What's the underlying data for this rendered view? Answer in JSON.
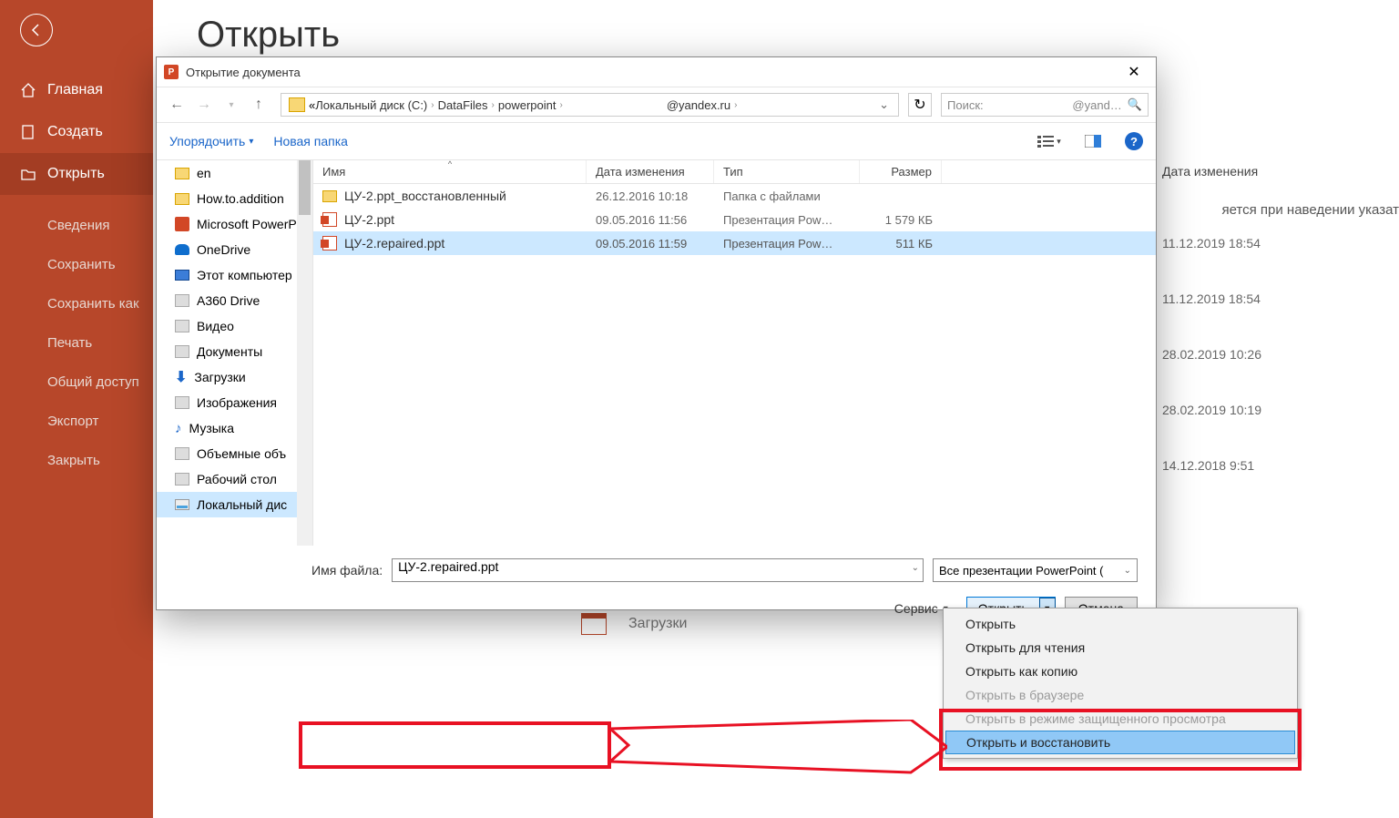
{
  "backstage": {
    "title": "Открыть",
    "nav": {
      "home": "Главная",
      "new": "Создать",
      "open": "Открыть"
    },
    "subnav": [
      "Сведения",
      "Сохранить",
      "Сохранить как",
      "Печать",
      "Общий доступ",
      "Экспорт",
      "Закрыть"
    ]
  },
  "right_panel": {
    "header": "Дата изменения",
    "truncated": "яется при наведении указат",
    "rows": [
      "11.12.2019 18:54",
      "11.12.2019 18:54",
      "28.02.2019 10:26",
      "28.02.2019 10:19",
      "14.12.2018 9:51"
    ]
  },
  "downloads_hint": "Загрузки",
  "dialog": {
    "title": "Открытие документа",
    "breadcrumb": {
      "pre": "«",
      "segments": [
        "Локальный диск (C:)",
        "DataFiles",
        "powerpoint",
        "",
        "@yandex.ru"
      ]
    },
    "search": {
      "label": "Поиск:",
      "placeholder": "@yand…"
    },
    "toolbar": {
      "organize": "Упорядочить",
      "newfolder": "Новая папка"
    },
    "tree": [
      {
        "icon": "folder",
        "label": "en"
      },
      {
        "icon": "folder",
        "label": "How.to.addition"
      },
      {
        "icon": "ppt",
        "label": "Microsoft PowerP"
      },
      {
        "icon": "onedrive",
        "label": "OneDrive"
      },
      {
        "icon": "pc",
        "label": "Этот компьютер"
      },
      {
        "icon": "gen",
        "label": "A360 Drive"
      },
      {
        "icon": "gen",
        "label": "Видео"
      },
      {
        "icon": "gen",
        "label": "Документы"
      },
      {
        "icon": "down",
        "label": "Загрузки"
      },
      {
        "icon": "gen",
        "label": "Изображения"
      },
      {
        "icon": "music",
        "label": "Музыка"
      },
      {
        "icon": "gen",
        "label": "Объемные объ"
      },
      {
        "icon": "gen",
        "label": "Рабочий стол"
      },
      {
        "icon": "disk",
        "label": "Локальный дис",
        "selected": true
      }
    ],
    "columns": {
      "name": "Имя",
      "date": "Дата изменения",
      "type": "Тип",
      "size": "Размер"
    },
    "rows": [
      {
        "icon": "folder",
        "name": "ЦУ-2.ppt_восстановленный",
        "date": "26.12.2016 10:18",
        "type": "Папка с файлами",
        "size": ""
      },
      {
        "icon": "pptfile",
        "name": "ЦУ-2.ppt",
        "date": "09.05.2016 11:56",
        "type": "Презентация Pow…",
        "size": "1 579 КБ"
      },
      {
        "icon": "pptfile",
        "name": "ЦУ-2.repaired.ppt",
        "date": "09.05.2016 11:59",
        "type": "Презентация Pow…",
        "size": "511 КБ",
        "selected": true
      }
    ],
    "filename_label": "Имя файла:",
    "filename_value": "ЦУ-2.repaired.ppt",
    "filter": "Все презентации PowerPoint (",
    "service": "Сервис",
    "open_btn": "Открыть",
    "cancel_btn": "Отмена"
  },
  "open_menu": {
    "items": [
      {
        "label": "Открыть"
      },
      {
        "label": "Открыть для чтения"
      },
      {
        "label": "Открыть как копию"
      },
      {
        "label": "Открыть в браузере",
        "disabled": true
      },
      {
        "label": "Открыть в режиме защищенного просмотра",
        "disabled": true
      },
      {
        "label": "Открыть и восстановить",
        "highlight": true
      }
    ]
  }
}
